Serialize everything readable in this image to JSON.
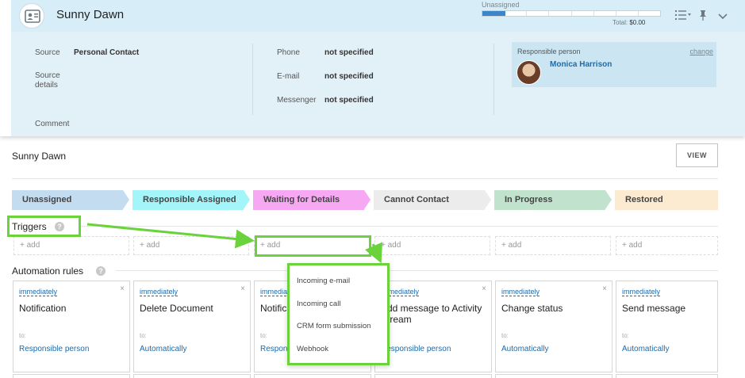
{
  "header": {
    "contact_name": "Sunny Dawn",
    "stage_label": "Unassigned",
    "progress": 0.13,
    "progress_segments": 8,
    "total_label": "Total:",
    "total_value": "$0.00"
  },
  "details": {
    "source_label": "Source",
    "source_value": "Personal Contact",
    "source_details_label": "Source details",
    "comment_label": "Comment",
    "phone_label": "Phone",
    "phone_value": "not specified",
    "email_label": "E-mail",
    "email_value": "not specified",
    "messenger_label": "Messenger",
    "messenger_value": "not specified"
  },
  "responsible": {
    "label": "Responsible person",
    "change": "change",
    "name": "Monica Harrison"
  },
  "section": {
    "title": "Sunny Dawn",
    "view_button": "VIEW"
  },
  "stages": [
    {
      "label": "Unassigned",
      "color": "#c3dcf0"
    },
    {
      "label": "Responsible Assigned",
      "color": "#a4f5fa"
    },
    {
      "label": "Waiting for Details",
      "color": "#f6a9f2"
    },
    {
      "label": "Cannot Contact",
      "color": "#ececec"
    },
    {
      "label": "In Progress",
      "color": "#c1e3cd"
    },
    {
      "label": "Restored",
      "color": "#fcebd0"
    }
  ],
  "triggers": {
    "label": "Triggers",
    "help": "?",
    "add_label": "+ add"
  },
  "automation": {
    "label": "Automation rules",
    "help": "?",
    "close": "×",
    "to_label": "to:",
    "rules": [
      {
        "when": "immediately",
        "title": "Notification",
        "target": "Responsible person"
      },
      {
        "when": "immediately",
        "title": "Delete Document",
        "target": "Automatically"
      },
      {
        "when": "immediately",
        "title": "Notification",
        "target": "Responsible person"
      },
      {
        "when": "immediately",
        "title": "Add message to Activity Stream",
        "target": "Responsible person"
      },
      {
        "when": "immediately",
        "title": "Change status",
        "target": "Automatically"
      },
      {
        "when": "immediately",
        "title": "Send message",
        "target": "Automatically"
      }
    ]
  },
  "dropdown": {
    "items": [
      "Incoming e-mail",
      "Incoming call",
      "CRM form submission",
      "Webhook"
    ]
  },
  "colors": {
    "accent_blue": "#1f6aa8",
    "highlight_green": "#6ad23b",
    "header_bg": "#d7eef8",
    "details_bg": "#e2f1f8"
  }
}
